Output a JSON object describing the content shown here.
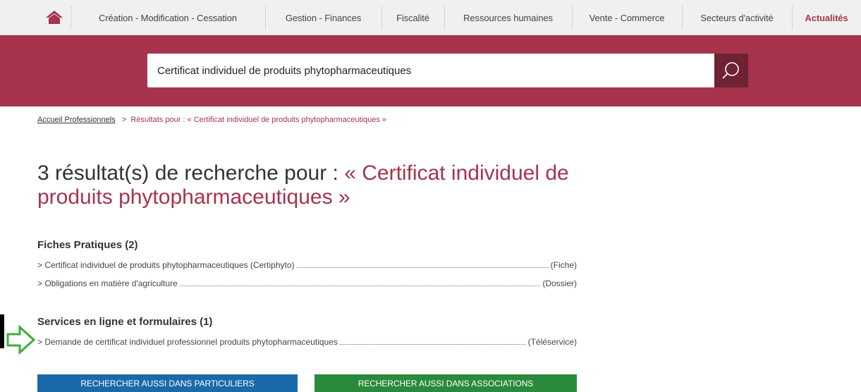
{
  "nav": {
    "home_icon": "home-icon",
    "items": [
      "Création - Modification - Cessation",
      "Gestion - Finances",
      "Fiscalité",
      "Ressources humaines",
      "Vente - Commerce",
      "Secteurs d'activité",
      "Actualités"
    ],
    "active_color": "#a6344c"
  },
  "search": {
    "value": "Certificat individuel de produits phytopharmaceutiques",
    "icon": "search-icon",
    "band_color": "#a6344c"
  },
  "breadcrumb": {
    "home": "Accueil Professionnels",
    "separator": ">",
    "current": "Résultats pour : « Certificat individuel de produits phytopharmaceutiques »"
  },
  "heading": {
    "prefix": "3 résultat(s) de recherche pour : ",
    "query": "« Certificat individuel de produits phytopharmaceutiques »"
  },
  "sections": [
    {
      "title": "Fiches Pratiques (2)",
      "items": [
        {
          "label": "> Certificat individuel de produits phytopharmaceutiques (Certiphyto)",
          "type": "(Fiche)"
        },
        {
          "label": "> Obligations en matière d'agriculture",
          "type": "(Dossier)"
        }
      ]
    },
    {
      "title": "Services en ligne et formulaires (1)",
      "items": [
        {
          "label": "> Demande de certificat individuel professionnel produits phytopharmaceutiques",
          "type": "(Téléservice)"
        }
      ]
    }
  ],
  "buttons": {
    "particuliers": "RECHERCHER AUSSI DANS PARTICULIERS",
    "associations": "RECHERCHER AUSSI DANS ASSOCIATIONS",
    "blue": "#1a6aaa",
    "green": "#2a8a3c"
  }
}
